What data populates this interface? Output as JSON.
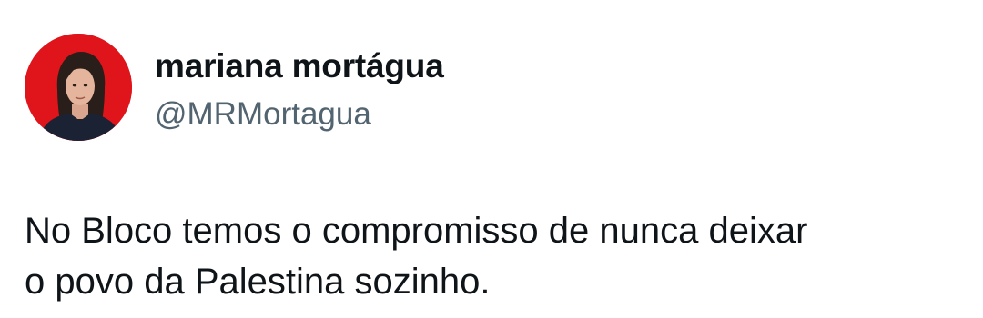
{
  "tweet": {
    "author": {
      "display_name": "mariana mortágua",
      "handle": "@MRMortagua"
    },
    "text": "No Bloco temos o compromisso de nunca deixar\no povo da Palestina sozinho."
  },
  "colors": {
    "avatar_background": "#e0151b",
    "name_color": "#0f1419",
    "handle_color": "#536471",
    "text_color": "#0f1419"
  },
  "icons": {
    "avatar": "profile-photo"
  }
}
